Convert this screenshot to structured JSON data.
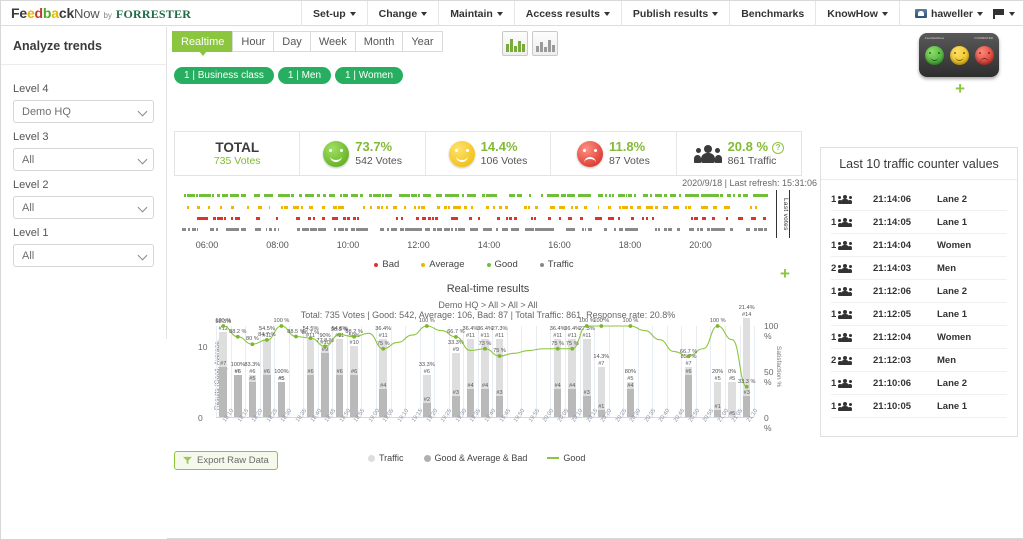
{
  "brand": {
    "feedback_fee": "F",
    "name_feedback": "Feedback",
    "name_now": "Now",
    "by": "by",
    "forrester": "FORRESTER"
  },
  "topnav": {
    "items": [
      {
        "label": "Set-up",
        "caret": true
      },
      {
        "label": "Change",
        "caret": true
      },
      {
        "label": "Maintain",
        "caret": true
      },
      {
        "label": "Access results",
        "caret": true
      },
      {
        "label": "Publish results",
        "caret": true
      },
      {
        "label": "Benchmarks",
        "caret": false
      },
      {
        "label": "KnowHow",
        "caret": true
      }
    ],
    "user": "haweller"
  },
  "sidebar": {
    "title": "Analyze trends",
    "filters": [
      {
        "label": "Level 4",
        "value": "Demo HQ"
      },
      {
        "label": "Level 3",
        "value": "All"
      },
      {
        "label": "Level 2",
        "value": "All"
      },
      {
        "label": "Level 1",
        "value": "All"
      }
    ]
  },
  "tabs": [
    {
      "label": "Realtime",
      "active": true
    },
    {
      "label": "Hour",
      "active": false
    },
    {
      "label": "Day",
      "active": false
    },
    {
      "label": "Week",
      "active": false
    },
    {
      "label": "Month",
      "active": false
    },
    {
      "label": "Year",
      "active": false
    }
  ],
  "pills": [
    "1 | Business class",
    "1 | Men",
    "1 | Women"
  ],
  "kpis": {
    "total_label": "TOTAL",
    "total_votes": "735 Votes",
    "good_pct": "73.7%",
    "good_votes": "542 Votes",
    "avg_pct": "14.4%",
    "avg_votes": "106 Votes",
    "bad_pct": "11.8%",
    "bad_votes": "87 Votes",
    "traffic_pct": "20.8 %",
    "traffic_votes": "861 Traffic",
    "help_glyph": "?"
  },
  "refresh_text": "2020/9/18 | Last refresh: 15:31:06",
  "timeline": {
    "vertical_label": "Last votes",
    "axis_ticks": [
      "06:00",
      "08:00",
      "10:00",
      "12:00",
      "14:00",
      "16:00",
      "18:00",
      "20:00"
    ],
    "legend": [
      {
        "label": "Bad",
        "color": "#e03131"
      },
      {
        "label": "Average",
        "color": "#f1b400"
      },
      {
        "label": "Good",
        "color": "#6fbf3a"
      },
      {
        "label": "Traffic",
        "color": "#888888"
      }
    ]
  },
  "main_chart": {
    "export_label": "Export Raw Data",
    "legend": [
      {
        "label": "Traffic",
        "color": "#dddddd"
      },
      {
        "label": "Good & Average & Bad",
        "color": "#b0b0b0"
      },
      {
        "label": "Good",
        "color": "#8cc63e"
      }
    ]
  },
  "right_panel": {
    "title": "Last 10 traffic counter values",
    "rows": [
      {
        "count": "1",
        "time": "21:14:06",
        "lane": "Lane 2"
      },
      {
        "count": "1",
        "time": "21:14:05",
        "lane": "Lane 1"
      },
      {
        "count": "1",
        "time": "21:14:04",
        "lane": "Women"
      },
      {
        "count": "2",
        "time": "21:14:03",
        "lane": "Men"
      },
      {
        "count": "1",
        "time": "21:12:06",
        "lane": "Lane 2"
      },
      {
        "count": "1",
        "time": "21:12:05",
        "lane": "Lane 1"
      },
      {
        "count": "1",
        "time": "21:12:04",
        "lane": "Women"
      },
      {
        "count": "2",
        "time": "21:12:03",
        "lane": "Men"
      },
      {
        "count": "1",
        "time": "21:10:06",
        "lane": "Lane 2"
      },
      {
        "count": "1",
        "time": "21:10:05",
        "lane": "Lane 1"
      }
    ]
  },
  "chart_data": {
    "type": "bar",
    "title": "Real-time results",
    "subtitle1": "Demo HQ > All > All > All",
    "subtitle2": "Total: 735 Votes | Good: 542, Average: 106, Bad: 87 | Total Traffic: 861, Response rate: 20.8%",
    "xlabel": "",
    "ylabel": "Results (Good, Average, Bad)",
    "y2label": "Satisfaction %",
    "ylim": [
      0,
      13
    ],
    "yticks": [
      "0",
      "10"
    ],
    "y2lim": [
      0,
      100
    ],
    "y2ticks": [
      "0 %",
      "50 %",
      "100 %"
    ],
    "grid": true,
    "legend_position": "bottom",
    "categories": [
      "18:10",
      "18:15",
      "18:20",
      "18:25",
      "18:30",
      "18:35",
      "18:40",
      "18:45",
      "18:50",
      "18:55",
      "19:00",
      "19:05",
      "19:10",
      "19:15",
      "19:20",
      "19:25",
      "19:30",
      "19:35",
      "19:40",
      "19:45",
      "19:50",
      "19:55",
      "20:00",
      "20:05",
      "20:10",
      "20:15",
      "20:20",
      "20:25",
      "20:30",
      "20:35",
      "20:40",
      "20:45",
      "20:50",
      "20:55",
      "21:00",
      "21:05",
      "21:10"
    ],
    "series": [
      {
        "name": "Traffic",
        "type": "bar",
        "color": "#dedede",
        "values": [
          12,
          6,
          6,
          11,
          5,
          0,
          11,
          10,
          11,
          10,
          0,
          11,
          0,
          0,
          6,
          0,
          9,
          11,
          11,
          11,
          0,
          0,
          0,
          11,
          11,
          11,
          7,
          0,
          5,
          0,
          0,
          0,
          7,
          0,
          5,
          5,
          14
        ]
      },
      {
        "name": "Good & Average & Bad",
        "type": "bar",
        "color": "#b9b9b9",
        "values": [
          7,
          6,
          5,
          6,
          5,
          0,
          6,
          9,
          6,
          6,
          0,
          4,
          0,
          0,
          2,
          0,
          3,
          4,
          4,
          3,
          0,
          0,
          0,
          4,
          4,
          3,
          1,
          0,
          4,
          0,
          0,
          0,
          6,
          0,
          1,
          0,
          3
        ]
      },
      {
        "name": "Good",
        "type": "line",
        "color": "#8cc63e",
        "values": [
          100,
          88.2,
          80,
          54.5,
          100,
          null,
          54.5,
          80,
          54.5,
          50,
          null,
          36.4,
          null,
          null,
          33.3,
          null,
          33.3,
          36.4,
          36.4,
          27.3,
          null,
          null,
          null,
          36.4,
          36.4,
          27.3,
          14.3,
          null,
          80,
          null,
          null,
          null,
          85.7,
          null,
          20,
          0,
          21.4
        ]
      }
    ],
    "satisfaction_line_pct": [
      100,
      88.2,
      80,
      84.7,
      100,
      88.5,
      86.7,
      77.8,
      90.5,
      88.2,
      92.0,
      75,
      82,
      90,
      100,
      95,
      88,
      73,
      75,
      67,
      70,
      73,
      75,
      75,
      75,
      100,
      100,
      100,
      100,
      95,
      85,
      72,
      66.7,
      75,
      100,
      85,
      33.3
    ],
    "bar_pct_labels": [
      "58.3%",
      "100%",
      "83.3%",
      "54.5%",
      "100%",
      "",
      "54.5%",
      "90%",
      "54.5%",
      "50%",
      "",
      "36.4%",
      "",
      "",
      "33.3%",
      "",
      "33.3%",
      "36.4%",
      "36.4%",
      "27.3%",
      "",
      "",
      "",
      "36.4%",
      "36.4%",
      "27.3%",
      "14.3%",
      "",
      "80%",
      "",
      "",
      "",
      "85.7%",
      "",
      "20%",
      "0%",
      "21.4%"
    ],
    "bar_count_labels": [
      "#7",
      "#6",
      "#5",
      "#6",
      "#5",
      "",
      "#6",
      "#9",
      "#6",
      "#6",
      "",
      "#4",
      "",
      "",
      "#2",
      "",
      "#3",
      "#4",
      "#4",
      "#3",
      "",
      "",
      "",
      "#4",
      "#4",
      "#3",
      "#1",
      "",
      "#4",
      "",
      "",
      "",
      "#6",
      "",
      "#1",
      "#5",
      "#3"
    ],
    "traffic_count_labels": [
      "#12",
      "#6",
      "#6",
      "#11",
      "#5",
      "",
      "#11",
      "#10",
      "#11",
      "#10",
      "",
      "#11",
      "",
      "",
      "#6",
      "",
      "#9",
      "#11",
      "#11",
      "#11",
      "",
      "",
      "",
      "#11",
      "#11",
      "#11",
      "#7",
      "",
      "#5",
      "",
      "",
      "",
      "#7",
      "",
      "#5",
      "#5",
      "#14"
    ],
    "line_pct_labels": [
      "100 %",
      "88.2 %",
      "80 %",
      "84.7 %",
      "100 %",
      "88.5 %",
      "86.7 %",
      "77.8 %",
      "90.5 %",
      "88.2 %",
      "",
      "75 %",
      "",
      "",
      "100 %",
      "",
      "66.7 %",
      "",
      "73 %",
      "75 %",
      "",
      "",
      "",
      "75 %",
      "75 %",
      "100 %",
      "100 %",
      "",
      "100 %",
      "",
      "",
      "",
      "66.7 %",
      "",
      "100 %",
      "",
      "33.3 %"
    ]
  }
}
